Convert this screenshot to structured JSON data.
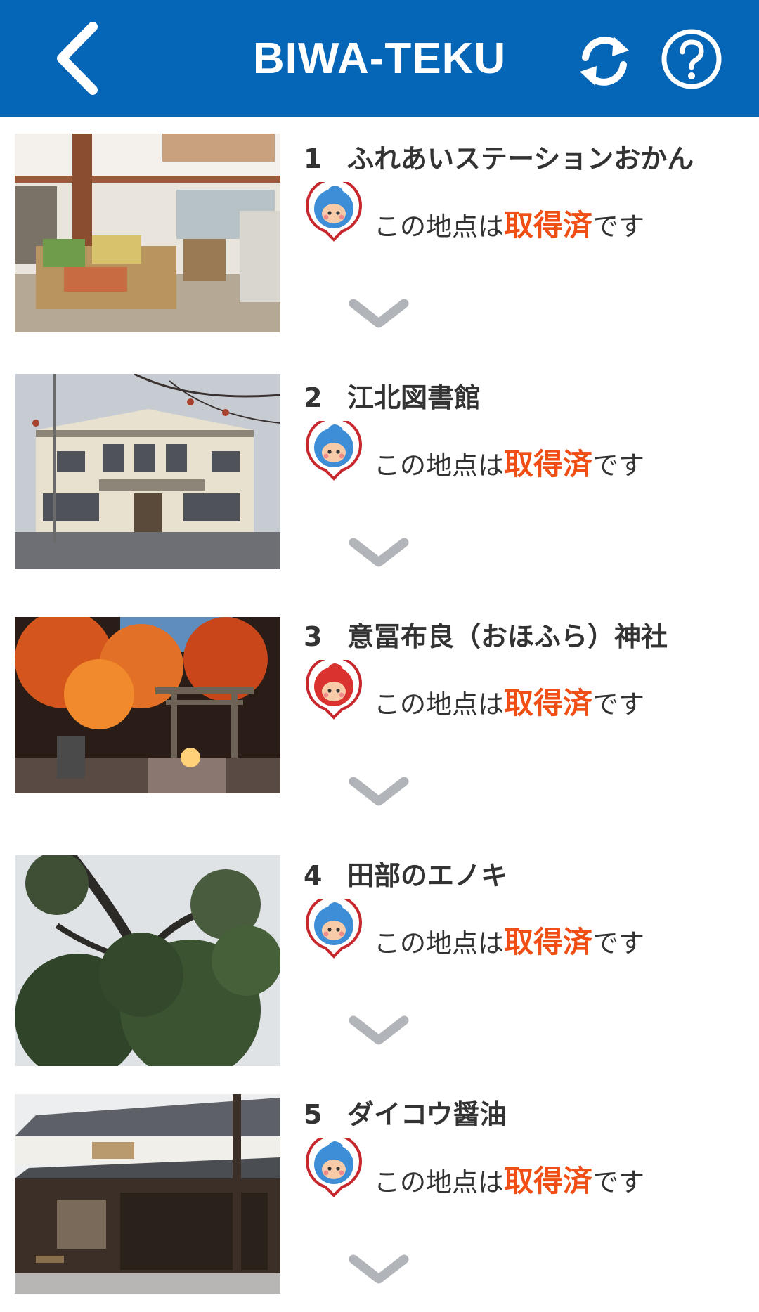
{
  "header": {
    "title": "BIWA-TEKU",
    "back_icon": "chevron-left-icon",
    "refresh_icon": "refresh-icon",
    "help_icon": "help-circle-icon",
    "background": "#0565b7"
  },
  "status_text": {
    "prefix": "この地点は",
    "highlight": "取得済",
    "suffix": "です",
    "highlight_color": "#ef4e15"
  },
  "spots": [
    {
      "number": "1",
      "name": "ふれあいステーションおかん",
      "badge_color": "blue"
    },
    {
      "number": "2",
      "name": "江北図書館",
      "badge_color": "blue"
    },
    {
      "number": "3",
      "name": "意冨布良（おほふら）神社",
      "badge_color": "red"
    },
    {
      "number": "4",
      "name": "田部のエノキ",
      "badge_color": "blue"
    },
    {
      "number": "5",
      "name": "ダイコウ醤油",
      "badge_color": "blue"
    }
  ]
}
